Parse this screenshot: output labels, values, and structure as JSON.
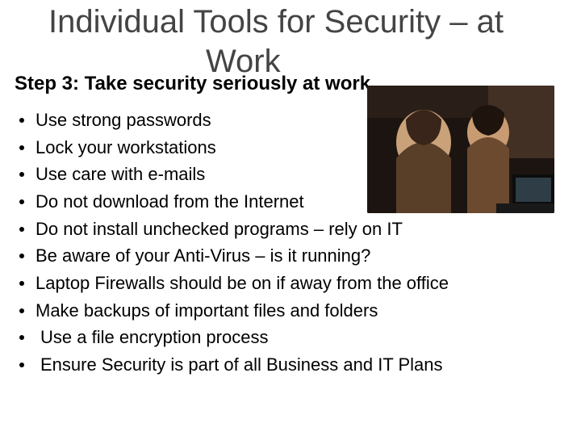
{
  "title_line1": "Individual Tools for Security – at",
  "title_line2": "Work",
  "subtitle": "Step 3: Take security seriously at work",
  "bullets": [
    "Use strong passwords",
    "Lock your workstations",
    "Use care with e-mails",
    "Do not download from the Internet",
    "Do not install unchecked programs – rely on IT",
    "Be aware of your Anti-Virus – is it running?",
    "Laptop Firewalls should be on if away from the office",
    "Make backups of important files and folders",
    " Use a file encryption process",
    " Ensure Security is part of all Business and IT Plans"
  ],
  "image_alt": "coworkers-at-laptop"
}
